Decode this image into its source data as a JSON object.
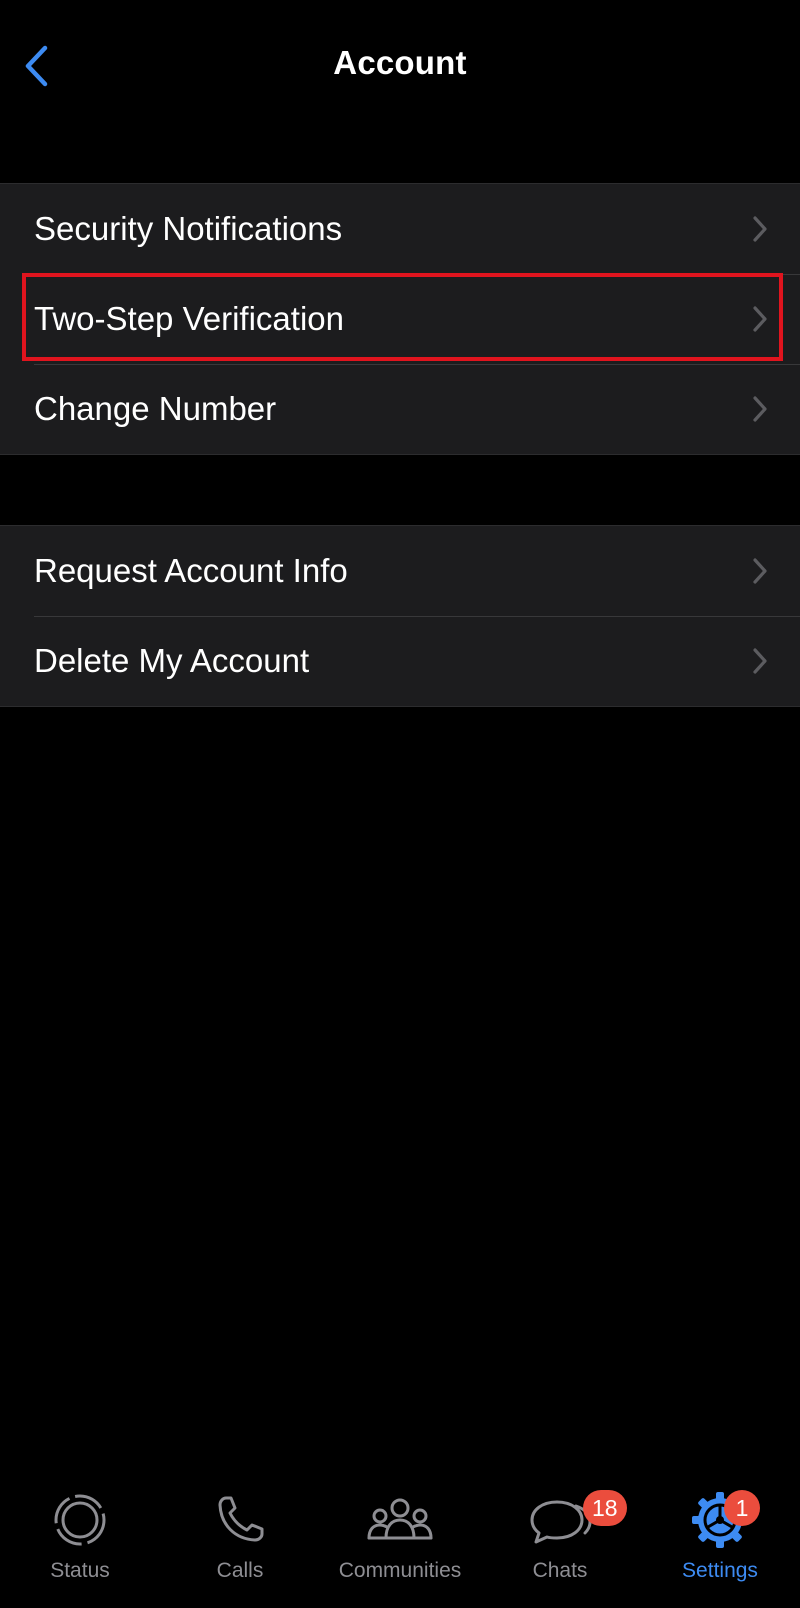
{
  "nav": {
    "title": "Account",
    "back_icon": "chevron-left-icon",
    "accent_color": "#3d8bf2"
  },
  "groups": [
    {
      "items": [
        {
          "label": "Security Notifications",
          "icon": "chevron-right-icon"
        },
        {
          "label": "Two-Step Verification",
          "icon": "chevron-right-icon",
          "highlighted": true
        },
        {
          "label": "Change Number",
          "icon": "chevron-right-icon"
        }
      ]
    },
    {
      "items": [
        {
          "label": "Request Account Info",
          "icon": "chevron-right-icon"
        },
        {
          "label": "Delete My Account",
          "icon": "chevron-right-icon"
        }
      ]
    }
  ],
  "highlight_color": "#e0141e",
  "tab_bar": {
    "tabs": [
      {
        "label": "Status",
        "icon": "status-icon",
        "active": false
      },
      {
        "label": "Calls",
        "icon": "phone-icon",
        "active": false
      },
      {
        "label": "Communities",
        "icon": "communities-icon",
        "active": false
      },
      {
        "label": "Chats",
        "icon": "chats-icon",
        "active": false,
        "badge": "18"
      },
      {
        "label": "Settings",
        "icon": "gear-icon",
        "active": true,
        "badge": "1"
      }
    ],
    "inactive_color": "#8e8e93",
    "active_color": "#3d8bf2",
    "badge_color": "#eb4d3d"
  }
}
